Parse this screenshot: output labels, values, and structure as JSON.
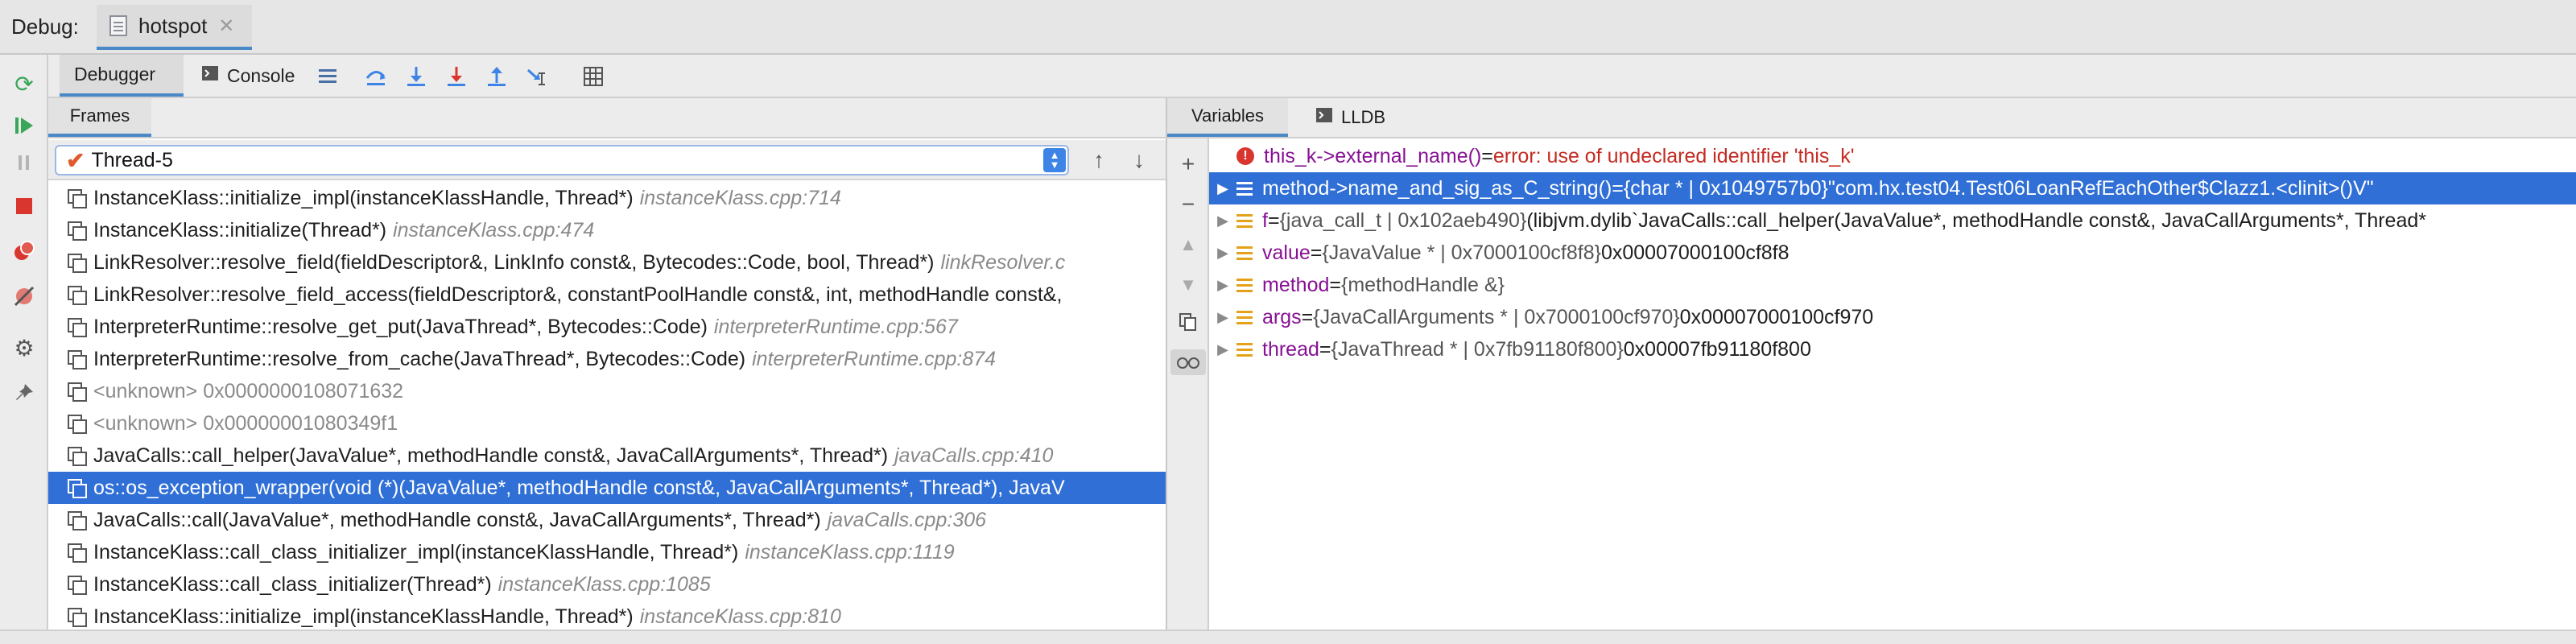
{
  "titlebar": {
    "debug_label": "Debug:",
    "tab_label": "hotspot"
  },
  "toolbar": {
    "debugger_tab": "Debugger",
    "console_tab": "Console"
  },
  "frames_panel": {
    "header": "Frames",
    "thread": "Thread-5",
    "frames": [
      {
        "fn": "InstanceKlass::initialize_impl(instanceKlassHandle, Thread*)",
        "loc": "instanceKlass.cpp:714",
        "kind": "normal"
      },
      {
        "fn": "InstanceKlass::initialize(Thread*)",
        "loc": "instanceKlass.cpp:474",
        "kind": "normal"
      },
      {
        "fn": "LinkResolver::resolve_field(fieldDescriptor&, LinkInfo const&, Bytecodes::Code, bool, Thread*)",
        "loc": "linkResolver.c",
        "kind": "normal"
      },
      {
        "fn": "LinkResolver::resolve_field_access(fieldDescriptor&, constantPoolHandle const&, int, methodHandle const&,",
        "loc": "",
        "kind": "normal"
      },
      {
        "fn": "InterpreterRuntime::resolve_get_put(JavaThread*, Bytecodes::Code)",
        "loc": "interpreterRuntime.cpp:567",
        "kind": "normal"
      },
      {
        "fn": "InterpreterRuntime::resolve_from_cache(JavaThread*, Bytecodes::Code)",
        "loc": "interpreterRuntime.cpp:874",
        "kind": "normal"
      },
      {
        "fn": "<unknown> 0x0000000108071632",
        "loc": "",
        "kind": "unknown"
      },
      {
        "fn": "<unknown> 0x00000001080349f1",
        "loc": "",
        "kind": "unknown"
      },
      {
        "fn": "JavaCalls::call_helper(JavaValue*, methodHandle const&, JavaCallArguments*, Thread*)",
        "loc": "javaCalls.cpp:410",
        "kind": "normal"
      },
      {
        "fn": "os::os_exception_wrapper(void (*)(JavaValue*, methodHandle const&, JavaCallArguments*, Thread*), JavaV",
        "loc": "",
        "kind": "selected"
      },
      {
        "fn": "JavaCalls::call(JavaValue*, methodHandle const&, JavaCallArguments*, Thread*)",
        "loc": "javaCalls.cpp:306",
        "kind": "normal"
      },
      {
        "fn": "InstanceKlass::call_class_initializer_impl(instanceKlassHandle, Thread*)",
        "loc": "instanceKlass.cpp:1119",
        "kind": "normal"
      },
      {
        "fn": "InstanceKlass::call_class_initializer(Thread*)",
        "loc": "instanceKlass.cpp:1085",
        "kind": "normal"
      },
      {
        "fn": "InstanceKlass::initialize_impl(instanceKlassHandle, Thread*)",
        "loc": "instanceKlass.cpp:810",
        "kind": "normal"
      }
    ]
  },
  "variables_panel": {
    "variables_tab": "Variables",
    "lldb_tab": "LLDB",
    "vars": [
      {
        "icon": "error",
        "expandable": false,
        "name": "this_k->external_name()",
        "eq": " = ",
        "type": "",
        "value": "",
        "error": "error: use of undeclared identifier 'this_k'",
        "selected": false
      },
      {
        "icon": "field",
        "expandable": true,
        "name": "method->name_and_sig_as_C_string()",
        "eq": " = ",
        "type": "{char * | 0x1049757b0}",
        "value": " \"com.hx.test04.Test06LoanRefEachOther$Clazz1.<clinit>()V\"",
        "error": "",
        "selected": true
      },
      {
        "icon": "field",
        "expandable": true,
        "name": "f",
        "eq": " = ",
        "type": "{java_call_t | 0x102aeb490}",
        "value": " (libjvm.dylib`JavaCalls::call_helper(JavaValue*, methodHandle const&, JavaCallArguments*, Thread*",
        "error": "",
        "selected": false
      },
      {
        "icon": "field",
        "expandable": true,
        "name": "value",
        "eq": " = ",
        "type": "{JavaValue * | 0x7000100cf8f8}",
        "value": " 0x00007000100cf8f8",
        "error": "",
        "selected": false
      },
      {
        "icon": "field",
        "expandable": true,
        "name": "method",
        "eq": " = ",
        "type": "{methodHandle &}",
        "value": "",
        "error": "",
        "selected": false
      },
      {
        "icon": "field",
        "expandable": true,
        "name": "args",
        "eq": " = ",
        "type": "{JavaCallArguments * | 0x7000100cf970}",
        "value": " 0x00007000100cf970",
        "error": "",
        "selected": false
      },
      {
        "icon": "field",
        "expandable": true,
        "name": "thread",
        "eq": " = ",
        "type": "{JavaThread * | 0x7fb91180f800}",
        "value": " 0x00007fb91180f800",
        "error": "",
        "selected": false
      }
    ]
  },
  "colors": {
    "accent": "#2f6fd6",
    "error": "#d9362f",
    "resume": "#3aa657",
    "stop": "#d9362f"
  }
}
